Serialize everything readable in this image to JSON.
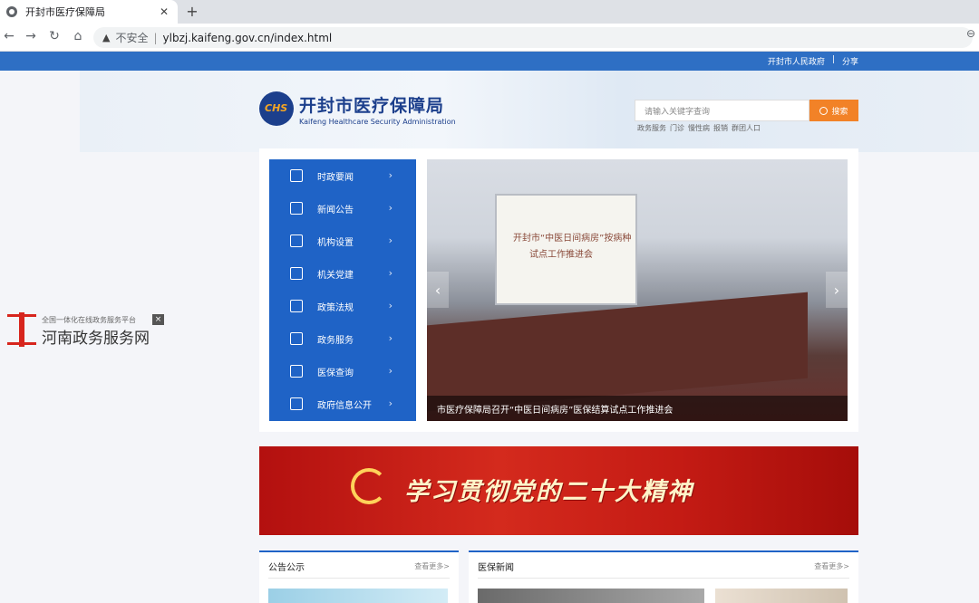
{
  "browser": {
    "tab_title": "开封市医疗保障局",
    "close_glyph": "✕",
    "newtab_glyph": "+",
    "back_glyph": "←",
    "forward_glyph": "→",
    "reload_glyph": "↻",
    "home_glyph": "⌂",
    "warning_glyph": "▲",
    "insecure_label": "不安全",
    "separator": "|",
    "url": "ylbzj.kaifeng.gov.cn/index.html",
    "zoom_glyph": "⊖"
  },
  "header": {
    "top_links": [
      "开封市人民政府",
      "|",
      "分享"
    ],
    "logo_abbr": "CHS",
    "logo_cn": "开封市医疗保障局",
    "logo_en": "Kaifeng Healthcare Security Administration",
    "search_placeholder": "请输入关键字查询",
    "search_button": "搜索",
    "hot_words": [
      "政务服务",
      "门诊",
      "慢性病",
      "报销",
      "群团人口"
    ]
  },
  "menu": {
    "items": [
      {
        "label": "时政要闻",
        "icon": "news-icon"
      },
      {
        "label": "新闻公告",
        "icon": "notice-icon"
      },
      {
        "label": "机构设置",
        "icon": "org-icon"
      },
      {
        "label": "机关党建",
        "icon": "building-icon"
      },
      {
        "label": "政策法规",
        "icon": "scale-icon"
      },
      {
        "label": "政务服务",
        "icon": "doc-icon"
      },
      {
        "label": "医保查询",
        "icon": "query-icon"
      },
      {
        "label": "政府信息公开",
        "icon": "layers-icon"
      }
    ],
    "chevron": "›"
  },
  "slider": {
    "screen_line1": "开封市“中医日间病房”按病种",
    "screen_line2": "试点工作推进会",
    "caption": "市医疗保障局召开“中医日间病房”医保结算试点工作推进会",
    "prev": "‹",
    "next": "›"
  },
  "banner": {
    "slogan": "学习贯彻党的二十大精神"
  },
  "panels": {
    "left_title": "公告公示",
    "left_more": "查看更多>",
    "right_title": "医保新闻",
    "right_more": "查看更多>"
  },
  "floater": {
    "small": "全国一体化在线政务服务平台",
    "big": "河南政务服务网",
    "close": "×"
  }
}
